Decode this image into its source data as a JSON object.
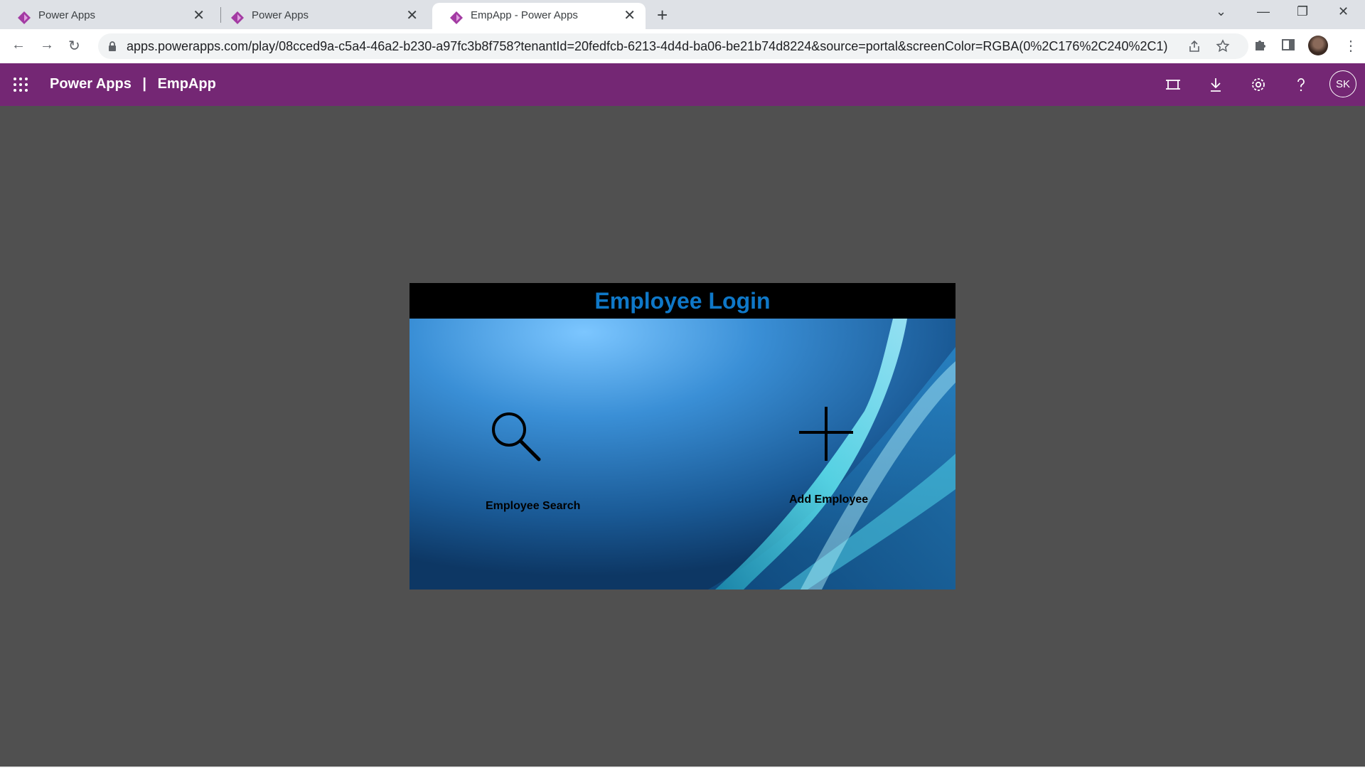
{
  "browser": {
    "tabs": [
      {
        "label": "Power Apps",
        "active": false
      },
      {
        "label": "Power Apps",
        "active": false
      },
      {
        "label": "EmpApp - Power Apps",
        "active": true
      }
    ],
    "url": "apps.powerapps.com/play/08cced9a-c5a4-46a2-b230-a97fc3b8f758?tenantId=20fedfcb-6213-4d4d-ba06-be21b74d8224&source=portal&screenColor=RGBA(0%2C176%2C240%2C1)"
  },
  "header": {
    "product": "Power Apps",
    "separator": "|",
    "app_name": "EmpApp",
    "user_initials": "SK",
    "color": "#742774"
  },
  "app": {
    "title": "Employee Login",
    "title_color": "#0f78c8",
    "search_label": "Employee Search",
    "add_label": "Add Employee"
  },
  "icons": [
    "app-launcher-icon",
    "fit-to-screen-icon",
    "download-icon",
    "settings-icon",
    "help-icon",
    "search-icon",
    "add-icon"
  ]
}
